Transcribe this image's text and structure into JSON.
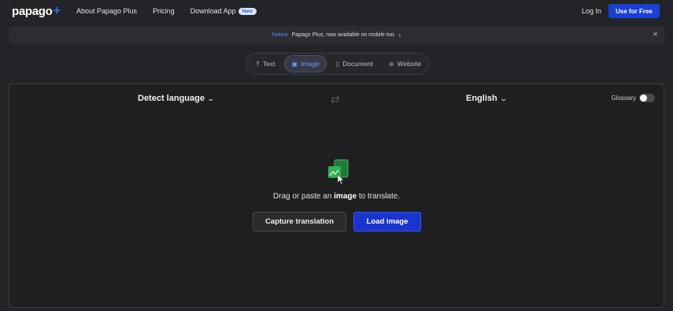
{
  "header": {
    "logo_text": "papago",
    "logo_plus": "+",
    "nav": [
      {
        "label": "About Papago Plus"
      },
      {
        "label": "Pricing"
      },
      {
        "label": "Download App",
        "badge": "New"
      }
    ],
    "login_label": "Log In",
    "cta_label": "Use for Free"
  },
  "notice": {
    "tag": "Notice",
    "message": "Papago Plus, now available on mobile too.",
    "chevron_icon": "chevron-right-icon",
    "close_icon": "close-icon"
  },
  "tabs": [
    {
      "label": "Text",
      "icon": "text-icon",
      "active": false
    },
    {
      "label": "Image",
      "icon": "image-icon",
      "active": true
    },
    {
      "label": "Document",
      "icon": "document-icon",
      "active": false
    },
    {
      "label": "Website",
      "icon": "globe-icon",
      "active": false
    }
  ],
  "translator": {
    "source_language": "Detect language",
    "target_language": "English",
    "glossary_label": "Glossary",
    "glossary_enabled": false,
    "hint_before": "Drag or paste an ",
    "hint_bold": "image",
    "hint_after": " to translate.",
    "capture_label": "Capture translation",
    "load_label": "Load image"
  },
  "colors": {
    "background": "#232427",
    "accent": "#1a3fd6",
    "active_tab_text": "#6f98ff",
    "illustration": "#2fb34f"
  }
}
